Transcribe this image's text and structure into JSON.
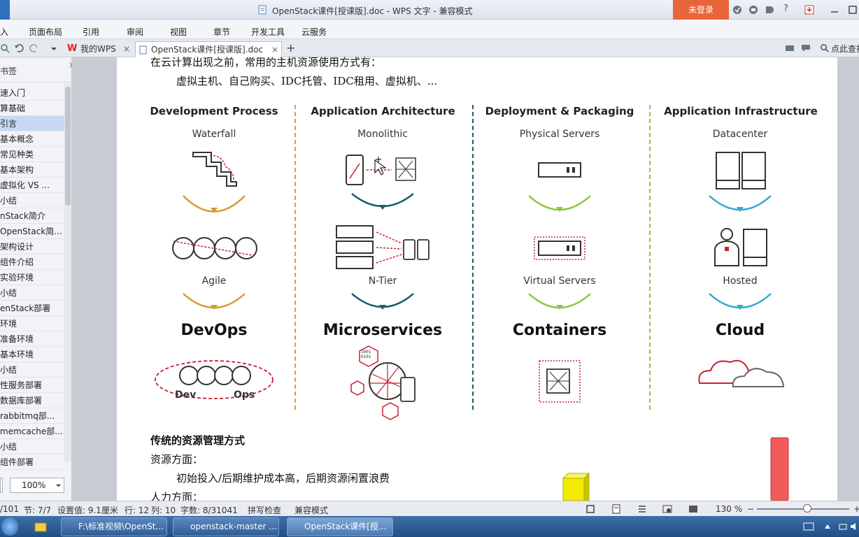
{
  "window": {
    "title": "OpenStack课件[授课版].doc - WPS 文字 - 兼容模式",
    "login_label": "未登录",
    "help_label": "?"
  },
  "menu": [
    "入",
    "页面布局",
    "引用",
    "审阅",
    "视图",
    "章节",
    "开发工具",
    "云服务"
  ],
  "tabs": [
    {
      "label": "我的WPS",
      "close": "×"
    },
    {
      "label": "OpenStack课件[授课版].doc",
      "close": "×"
    }
  ],
  "tab_add": "+",
  "search_label": "点此查找",
  "bookmarks": {
    "title": "书签",
    "close": "×",
    "items": [
      "速入门",
      "算基础",
      "引言",
      "基本概念",
      "常见种类",
      "基本架构",
      "虚拟化 VS ...",
      "小结",
      "nStack简介",
      "OpenStack简...",
      "架构设计",
      "组件介绍",
      "实验环境",
      "小结",
      "enStack部署",
      "环境",
      "准备环境",
      "基本环境",
      "小结",
      "性服务部署",
      "数据库部署",
      "rabbitmq部...",
      "memcache部...",
      "小结",
      "组件部署"
    ],
    "selected_index": 2,
    "zoom": "100%"
  },
  "document": {
    "line_top": "在云计算出现之前，常用的主机资源使用方式有：",
    "line_hosts": "虚拟主机、自己购买、IDC托管、IDC租用、虚拟机、...",
    "heading": "传统的资源管理方式",
    "line_resource": "资源方面：",
    "line_cost": "初始投入/后期维护成本高，后期资源闲置浪费",
    "line_people": "人力方面："
  },
  "figure": {
    "columns": [
      {
        "header": "Development Process",
        "top": "Waterfall",
        "middle": "Agile",
        "bottom": "DevOps",
        "color": "#d89a2b"
      },
      {
        "header": "Application Architecture",
        "top": "Monolithic",
        "middle": "N-Tier",
        "bottom": "Microservices",
        "color": "#1f5d6b"
      },
      {
        "header": "Deployment & Packaging",
        "top": "Physical Servers",
        "middle": "Virtual Servers",
        "bottom": "Containers",
        "color": "#8cc63f"
      },
      {
        "header": "Application Infrastructure",
        "top": "Datacenter",
        "middle": "Hosted",
        "bottom": "Cloud",
        "color": "#37a8cf"
      }
    ],
    "devops_labels": {
      "dev": "Dev",
      "ops": "Ops"
    },
    "binary_label": "1001\n0101",
    "accent_red": "#c8202f"
  },
  "status": {
    "page": "/101",
    "section": "节: 7/7",
    "setting": "设置值: 9.1厘米",
    "row": "行: 12",
    "col": "列: 10",
    "wordcount": "字数: 8/31041",
    "spell": "拼写检查",
    "mode": "兼容模式",
    "zoom": "130 %"
  },
  "taskbar": {
    "items": [
      {
        "label": "F:\\标准视频\\OpenSt..."
      },
      {
        "label": "openstack-master ..."
      },
      {
        "label": "OpenStack课件[授..."
      }
    ],
    "active_index": 2
  }
}
